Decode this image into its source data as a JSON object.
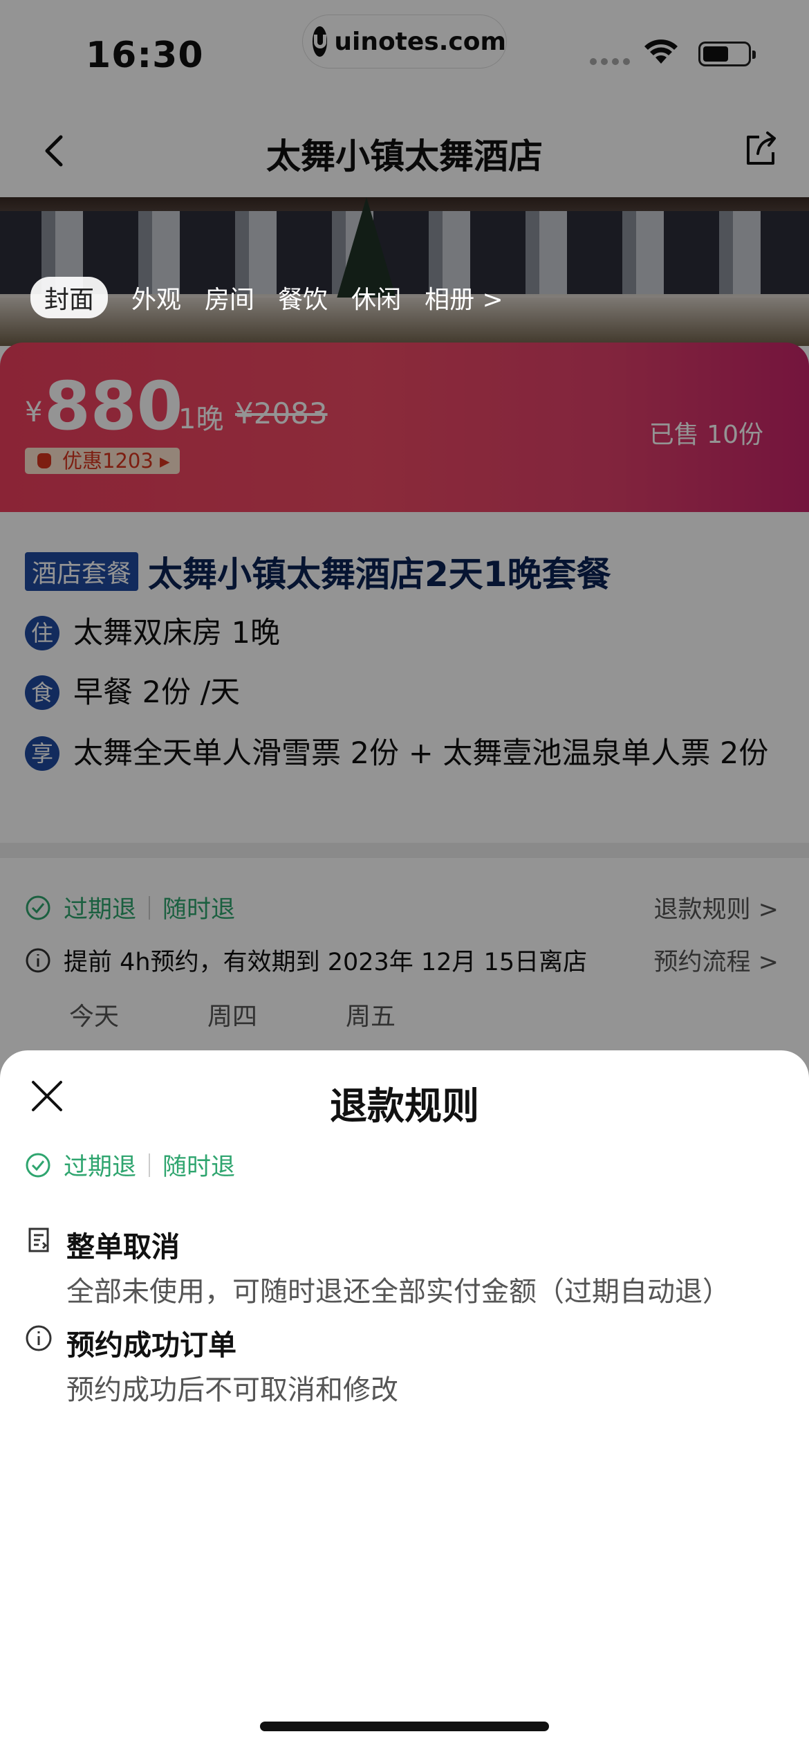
{
  "status_bar": {
    "time": "16:30",
    "watermark": "uinotes.com"
  },
  "nav": {
    "title": "太舞小镇太舞酒店",
    "back_icon": "chevron-left-icon",
    "share_icon": "share-icon"
  },
  "gallery_tabs": [
    "封面",
    "外观",
    "房间",
    "餐饮",
    "休闲",
    "相册 >"
  ],
  "price": {
    "currency": "¥",
    "amount": "880",
    "unit": "1晚",
    "original": "¥2083",
    "deal": "优惠1203 ▸",
    "sold": "已售 10份",
    "gradient_colors": [
      "#ee3f5e",
      "#c8246a"
    ]
  },
  "package": {
    "tag": "酒店套餐",
    "name": "太舞小镇太舞酒店2天1晚套餐",
    "rows": [
      {
        "badge": "住",
        "text": "太舞双床房 1晚"
      },
      {
        "badge": "食",
        "text": "早餐 2份 /天"
      },
      {
        "badge": "享",
        "text": "太舞全天单人滑雪票 2份 + 太舞壹池温泉单人票 2份"
      }
    ]
  },
  "refund_line": {
    "expire": "过期退",
    "anytime": "随时退",
    "rules_link": "退款规则 >",
    "notice": "提前 4h预约，有效期到 2023年 12月 15日离店",
    "flow_link": "预约流程 >"
  },
  "days": [
    "今天",
    "周四",
    "周五"
  ],
  "sheet": {
    "title": "退款规则",
    "badge_expire": "过期退",
    "badge_anytime": "随时退",
    "items": [
      {
        "icon": "receipt-icon",
        "title": "整单取消",
        "desc": "全部未使用，可随时退还全部实付金额（过期自动退）"
      },
      {
        "icon": "info-icon",
        "title": "预约成功订单",
        "desc": "预约成功后不可取消和修改"
      }
    ]
  },
  "accent_green": "#2fa56f",
  "accent_blue": "#1f4aa1"
}
